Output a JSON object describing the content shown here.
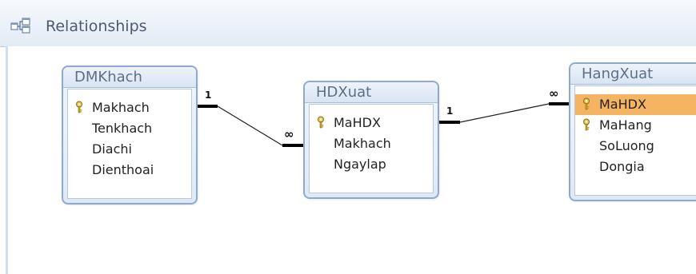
{
  "window": {
    "tab_title": "Relationships",
    "tab_icon": "relationships-icon"
  },
  "tables": [
    {
      "name": "DMKhach",
      "fields": [
        {
          "name": "Makhach",
          "key": true,
          "selected": false
        },
        {
          "name": "Tenkhach",
          "key": false,
          "selected": false
        },
        {
          "name": "Diachi",
          "key": false,
          "selected": false
        },
        {
          "name": "Dienthoai",
          "key": false,
          "selected": false
        }
      ]
    },
    {
      "name": "HDXuat",
      "fields": [
        {
          "name": "MaHDX",
          "key": true,
          "selected": false
        },
        {
          "name": "Makhach",
          "key": false,
          "selected": false
        },
        {
          "name": "Ngaylap",
          "key": false,
          "selected": false
        }
      ]
    },
    {
      "name": "HangXuat",
      "fields": [
        {
          "name": "MaHDX",
          "key": true,
          "selected": true
        },
        {
          "name": "MaHang",
          "key": true,
          "selected": false
        },
        {
          "name": "SoLuong",
          "key": false,
          "selected": false
        },
        {
          "name": "Dongia",
          "key": false,
          "selected": false
        }
      ]
    }
  ],
  "relationships": [
    {
      "one_label": "1",
      "many_label": "∞"
    },
    {
      "one_label": "1",
      "many_label": "∞"
    }
  ],
  "colors": {
    "accent": "#8ea9cf",
    "selected_field": "#f5b461",
    "key_icon": "#c9a227"
  }
}
